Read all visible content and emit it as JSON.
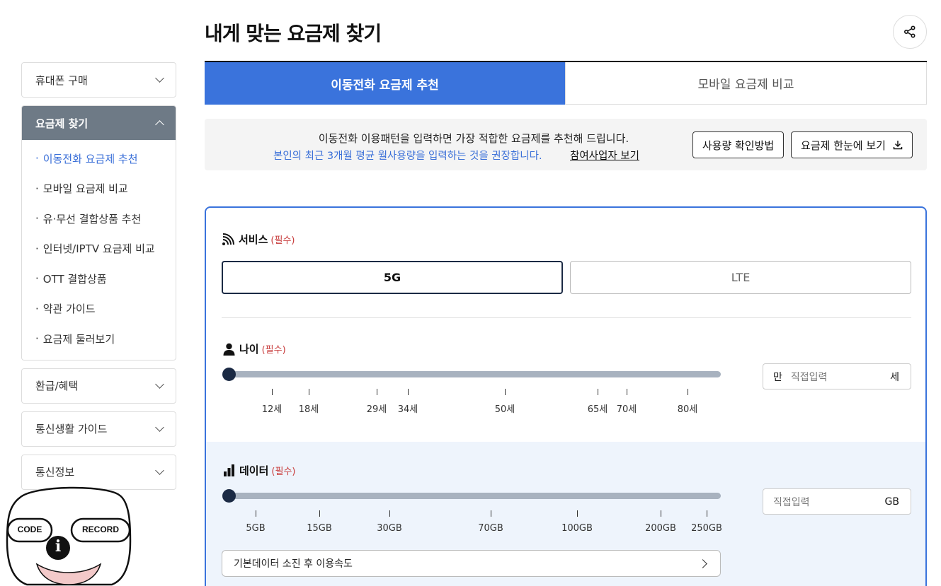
{
  "page": {
    "title": "내게 맞는 요금제 찾기"
  },
  "sidebar": {
    "top_menus": [
      {
        "label": "휴대폰 구매"
      }
    ],
    "active_menu": {
      "label": "요금제 찾기"
    },
    "sub_items": [
      {
        "label": "이동전화 요금제 추천"
      },
      {
        "label": "모바일 요금제 비교"
      },
      {
        "label": "유·무선 결합상품 추천"
      },
      {
        "label": "인터넷/IPTV 요금제 비교"
      },
      {
        "label": "OTT 결합상품"
      },
      {
        "label": "약관 가이드"
      },
      {
        "label": "요금제 둘러보기"
      }
    ],
    "bottom_menus": [
      {
        "label": "환급/혜택"
      },
      {
        "label": "통신생활 가이드"
      },
      {
        "label": "통신정보"
      }
    ]
  },
  "tabs": [
    {
      "label": "이동전화 요금제 추천"
    },
    {
      "label": "모바일 요금제 비교"
    }
  ],
  "info": {
    "line1": "이동전화 이용패턴을 입력하면 가장 적합한 요금제를 추천해 드립니다.",
    "line2": "본인의 최근 3개월 평균 월사용량을 입력하는 것을 권장합니다.",
    "link": "참여사업자 보기",
    "btn_usage": "사용량 확인방법",
    "btn_overview": "요금제 한눈에 보기"
  },
  "service": {
    "label": "서비스",
    "required": "(필수)",
    "options": [
      "5G",
      "LTE"
    ],
    "selected": "5G"
  },
  "age": {
    "label": "나이",
    "required": "(필수)",
    "ticks": [
      "12세",
      "18세",
      "29세",
      "34세",
      "50세",
      "65세",
      "70세",
      "80세"
    ],
    "tick_values": [
      12,
      18,
      29,
      34,
      50,
      65,
      70,
      80
    ],
    "input_prefix": "만",
    "input_placeholder": "직접입력",
    "input_unit": "세",
    "slider_value": 0
  },
  "data": {
    "label": "데이터",
    "required": "(필수)",
    "ticks": [
      "5GB",
      "15GB",
      "30GB",
      "70GB",
      "100GB",
      "200GB",
      "250GB"
    ],
    "input_placeholder": "직접입력",
    "input_unit": "GB",
    "slider_value": 0,
    "speed_row": "기본데이터 소진 후 이용속도"
  },
  "mascot": {
    "left_label": "CODE",
    "right_label": "RECORD",
    "badge": "i"
  },
  "colors": {
    "accent": "#3a73dc",
    "dark": "#1b2a44",
    "required": "#c83c3c",
    "link_blue": "#3a6fd8"
  }
}
